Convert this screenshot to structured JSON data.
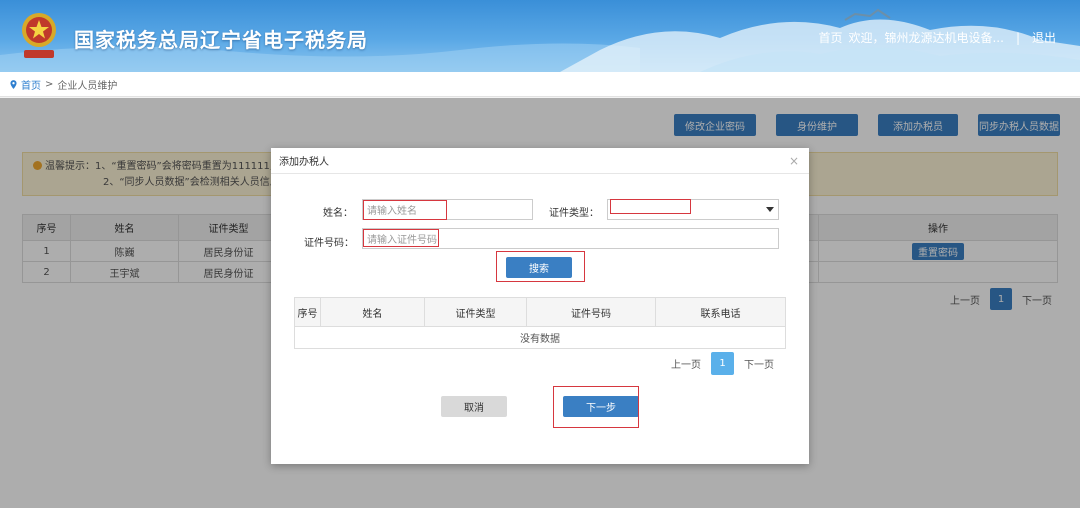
{
  "header": {
    "site_title": "国家税务总局辽宁省电子税务局",
    "logo_text": "中国税务",
    "nav": {
      "home": "首页",
      "welcome": "欢迎，锦州龙源达机电设备...",
      "separator": "|",
      "logout": "退出"
    }
  },
  "breadcrumb": {
    "home": "首页",
    "sep": ">",
    "current": "企业人员维护"
  },
  "toolbar": {
    "change_password": "修改企业密码",
    "identity_maintain": "身份维护",
    "add_taxpayer": "添加办税员",
    "sync_data": "同步办税人员数据"
  },
  "tips": {
    "line1": "温馨提示：1、“重置密码”会将密码重置为111111,",
    "line2": "2、“同步人员数据”会检测相关人员信息"
  },
  "people_table": {
    "headers": [
      "序号",
      "姓名",
      "证件类型",
      "操作"
    ],
    "rows": [
      {
        "no": "1",
        "name": "陈巍",
        "id_type": "居民身份证",
        "action": "重置密码"
      },
      {
        "no": "2",
        "name": "王宇斌",
        "id_type": "居民身份证",
        "action": ""
      }
    ]
  },
  "main_pager": {
    "prev": "上一页",
    "current": "1",
    "next": "下一页"
  },
  "modal": {
    "title": "添加办税人",
    "close": "×",
    "name_label": "姓名：",
    "name_placeholder": "请输入姓名",
    "id_type_label": "证件类型：",
    "id_number_label": "证件号码：",
    "id_number_placeholder": "请输入证件号码",
    "search": "搜索",
    "table": {
      "headers": [
        "序号",
        "姓名",
        "证件类型",
        "证件号码",
        "联系电话"
      ],
      "empty": "没有数据"
    },
    "pager": {
      "prev": "上一页",
      "current": "1",
      "next": "下一页"
    },
    "cancel": "取消",
    "next_step": "下一步"
  },
  "colors": {
    "primary": "#3a7fc3",
    "highlight": "#d6373f",
    "header": "#3a8fd8"
  }
}
